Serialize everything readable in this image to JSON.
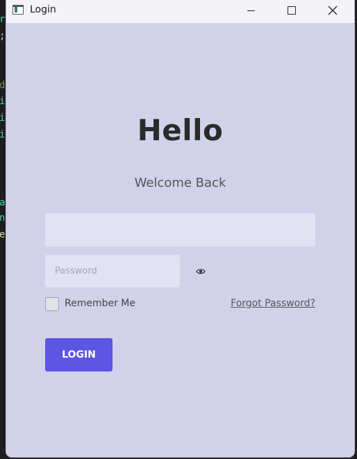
{
  "window": {
    "title": "Login"
  },
  "main": {
    "heading": "Hello",
    "subheading": "Welcome Back",
    "username": {
      "value": "",
      "placeholder": ""
    },
    "password": {
      "value": "",
      "placeholder": "Password"
    },
    "remember_label": "Remember Me",
    "remember_checked": false,
    "forgot_label": "Forgot Password?",
    "login_label": "LOGIN"
  },
  "colors": {
    "background": "#d2d1ea",
    "input_bg": "#e1e2f2",
    "accent": "#5d55e3",
    "titlebar": "#f3f3f8"
  },
  "icons": {
    "app": "app-icon",
    "minimize": "minimize-icon",
    "maximize": "maximize-icon",
    "close": "close-icon",
    "password_toggle": "eye-icon"
  }
}
